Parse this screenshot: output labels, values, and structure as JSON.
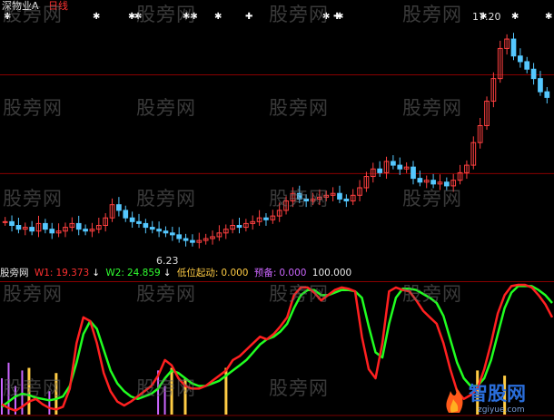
{
  "header": {
    "stock_name": "深物业A",
    "period": "日线"
  },
  "price_panel": {
    "high_label": "17.20",
    "low_label": "6.23",
    "ylim": [
      5.2,
      18.5
    ],
    "gridlines": [
      9.95,
      15.2
    ],
    "signal_marks": [
      "✱",
      "✱",
      "✱",
      "✱",
      "✱✱",
      "✱",
      "✚",
      "✱",
      "✚",
      "✱",
      "✱",
      "✱",
      "✱"
    ],
    "closes": [
      7.4,
      7.2,
      7.0,
      7.1,
      6.9,
      7.3,
      7.0,
      6.8,
      6.9,
      7.1,
      7.3,
      7.0,
      6.9,
      7.0,
      7.2,
      7.6,
      8.3,
      8.0,
      7.6,
      7.4,
      7.3,
      7.1,
      7.0,
      6.9,
      6.8,
      6.7,
      6.5,
      6.4,
      6.3,
      6.4,
      6.5,
      6.6,
      6.8,
      7.0,
      7.2,
      7.1,
      7.3,
      7.4,
      7.6,
      7.5,
      7.7,
      8.0,
      8.5,
      8.9,
      8.6,
      8.5,
      8.6,
      8.7,
      8.8,
      8.9,
      8.6,
      8.5,
      8.8,
      9.2,
      9.8,
      10.2,
      10.0,
      10.6,
      10.4,
      10.2,
      10.3,
      9.7,
      9.5,
      9.6,
      9.4,
      9.5,
      9.3,
      9.6,
      10.0,
      10.4,
      11.6,
      12.5,
      13.8,
      15.0,
      16.6,
      17.1,
      16.2,
      15.9,
      15.5,
      15.0,
      14.3,
      14.0
    ],
    "colors": {
      "up": "#ff4040",
      "down": "#55c8ff",
      "grid": "#8a0000",
      "marks": "#ffffff"
    }
  },
  "indicator_panel": {
    "brand": "股旁网",
    "w1_label": "W1:",
    "w1_value": "19.373",
    "w1_arrow": "↓",
    "w2_label": "W2:",
    "w2_value": "24.859",
    "w2_arrow": "↓",
    "start_label": "低位起动:",
    "start_value": "0.000",
    "ready_label": "预备:",
    "ready_value": "0.000",
    "extra_value": "100.000",
    "ylim": [
      0,
      100
    ],
    "x_count": 82,
    "w1_series": [
      8,
      5,
      3,
      6,
      10,
      12,
      8,
      5,
      4,
      6,
      20,
      55,
      75,
      72,
      55,
      32,
      18,
      10,
      7,
      10,
      14,
      18,
      22,
      30,
      42,
      38,
      28,
      22,
      20,
      20,
      22,
      26,
      30,
      34,
      42,
      45,
      50,
      55,
      60,
      58,
      62,
      68,
      75,
      92,
      98,
      98,
      94,
      88,
      92,
      96,
      98,
      97,
      95,
      60,
      35,
      28,
      55,
      95,
      98,
      96,
      95,
      88,
      80,
      75,
      70,
      55,
      35,
      18,
      12,
      15,
      20,
      35,
      55,
      78,
      92,
      99,
      100,
      100,
      98,
      92,
      85,
      75
    ],
    "w2_series": [
      6,
      10,
      14,
      16,
      15,
      13,
      12,
      11,
      12,
      14,
      22,
      40,
      62,
      72,
      66,
      50,
      34,
      24,
      18,
      14,
      12,
      14,
      16,
      20,
      28,
      34,
      32,
      28,
      24,
      22,
      22,
      24,
      26,
      30,
      34,
      38,
      42,
      48,
      54,
      58,
      60,
      64,
      70,
      82,
      92,
      96,
      96,
      92,
      92,
      94,
      96,
      96,
      95,
      90,
      68,
      48,
      44,
      70,
      90,
      97,
      97,
      96,
      93,
      90,
      86,
      76,
      58,
      40,
      28,
      22,
      22,
      28,
      42,
      62,
      82,
      94,
      99,
      99,
      99,
      96,
      92,
      86
    ],
    "purple_bars": [
      {
        "x": 0,
        "v": 28
      },
      {
        "x": 1,
        "v": 40
      },
      {
        "x": 2,
        "v": 22
      },
      {
        "x": 3,
        "v": 34
      },
      {
        "x": 7,
        "v": 18
      },
      {
        "x": 23,
        "v": 34
      },
      {
        "x": 24,
        "v": 22
      }
    ],
    "yellow_bars": [
      {
        "x": 4,
        "v": 36
      },
      {
        "x": 8,
        "v": 32
      },
      {
        "x": 25,
        "v": 36
      },
      {
        "x": 27,
        "v": 28
      },
      {
        "x": 33,
        "v": 36
      },
      {
        "x": 70,
        "v": 34
      },
      {
        "x": 74,
        "v": 30
      }
    ],
    "colors": {
      "w1": "#ff2020",
      "w2": "#20ff20",
      "purple": "#cc66ff",
      "yellow": "#ffcc44",
      "separator": "#8a0000",
      "baseline": "#7a0000"
    }
  },
  "watermark": "股旁网",
  "logo": {
    "name": "智股网",
    "domain": "zgiyue.com"
  }
}
